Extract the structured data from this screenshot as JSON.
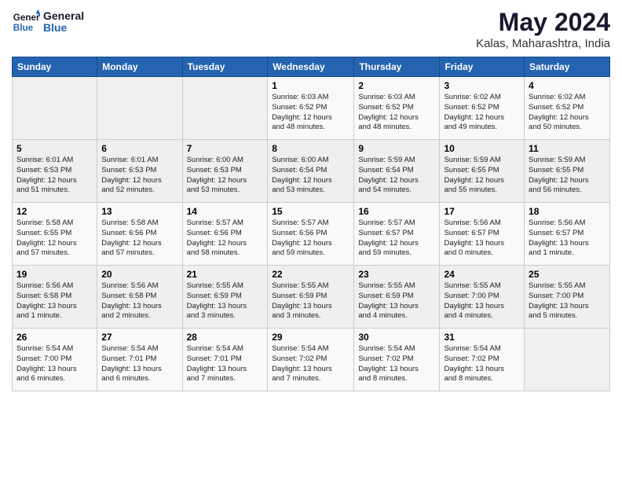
{
  "logo": {
    "line1": "General",
    "line2": "Blue"
  },
  "title": "May 2024",
  "subtitle": "Kalas, Maharashtra, India",
  "days_of_week": [
    "Sunday",
    "Monday",
    "Tuesday",
    "Wednesday",
    "Thursday",
    "Friday",
    "Saturday"
  ],
  "weeks": [
    [
      {
        "day": "",
        "info": ""
      },
      {
        "day": "",
        "info": ""
      },
      {
        "day": "",
        "info": ""
      },
      {
        "day": "1",
        "info": "Sunrise: 6:03 AM\nSunset: 6:52 PM\nDaylight: 12 hours\nand 48 minutes."
      },
      {
        "day": "2",
        "info": "Sunrise: 6:03 AM\nSunset: 6:52 PM\nDaylight: 12 hours\nand 48 minutes."
      },
      {
        "day": "3",
        "info": "Sunrise: 6:02 AM\nSunset: 6:52 PM\nDaylight: 12 hours\nand 49 minutes."
      },
      {
        "day": "4",
        "info": "Sunrise: 6:02 AM\nSunset: 6:52 PM\nDaylight: 12 hours\nand 50 minutes."
      }
    ],
    [
      {
        "day": "5",
        "info": "Sunrise: 6:01 AM\nSunset: 6:53 PM\nDaylight: 12 hours\nand 51 minutes."
      },
      {
        "day": "6",
        "info": "Sunrise: 6:01 AM\nSunset: 6:53 PM\nDaylight: 12 hours\nand 52 minutes."
      },
      {
        "day": "7",
        "info": "Sunrise: 6:00 AM\nSunset: 6:53 PM\nDaylight: 12 hours\nand 53 minutes."
      },
      {
        "day": "8",
        "info": "Sunrise: 6:00 AM\nSunset: 6:54 PM\nDaylight: 12 hours\nand 53 minutes."
      },
      {
        "day": "9",
        "info": "Sunrise: 5:59 AM\nSunset: 6:54 PM\nDaylight: 12 hours\nand 54 minutes."
      },
      {
        "day": "10",
        "info": "Sunrise: 5:59 AM\nSunset: 6:55 PM\nDaylight: 12 hours\nand 55 minutes."
      },
      {
        "day": "11",
        "info": "Sunrise: 5:59 AM\nSunset: 6:55 PM\nDaylight: 12 hours\nand 56 minutes."
      }
    ],
    [
      {
        "day": "12",
        "info": "Sunrise: 5:58 AM\nSunset: 6:55 PM\nDaylight: 12 hours\nand 57 minutes."
      },
      {
        "day": "13",
        "info": "Sunrise: 5:58 AM\nSunset: 6:56 PM\nDaylight: 12 hours\nand 57 minutes."
      },
      {
        "day": "14",
        "info": "Sunrise: 5:57 AM\nSunset: 6:56 PM\nDaylight: 12 hours\nand 58 minutes."
      },
      {
        "day": "15",
        "info": "Sunrise: 5:57 AM\nSunset: 6:56 PM\nDaylight: 12 hours\nand 59 minutes."
      },
      {
        "day": "16",
        "info": "Sunrise: 5:57 AM\nSunset: 6:57 PM\nDaylight: 12 hours\nand 59 minutes."
      },
      {
        "day": "17",
        "info": "Sunrise: 5:56 AM\nSunset: 6:57 PM\nDaylight: 13 hours\nand 0 minutes."
      },
      {
        "day": "18",
        "info": "Sunrise: 5:56 AM\nSunset: 6:57 PM\nDaylight: 13 hours\nand 1 minute."
      }
    ],
    [
      {
        "day": "19",
        "info": "Sunrise: 5:56 AM\nSunset: 6:58 PM\nDaylight: 13 hours\nand 1 minute."
      },
      {
        "day": "20",
        "info": "Sunrise: 5:56 AM\nSunset: 6:58 PM\nDaylight: 13 hours\nand 2 minutes."
      },
      {
        "day": "21",
        "info": "Sunrise: 5:55 AM\nSunset: 6:59 PM\nDaylight: 13 hours\nand 3 minutes."
      },
      {
        "day": "22",
        "info": "Sunrise: 5:55 AM\nSunset: 6:59 PM\nDaylight: 13 hours\nand 3 minutes."
      },
      {
        "day": "23",
        "info": "Sunrise: 5:55 AM\nSunset: 6:59 PM\nDaylight: 13 hours\nand 4 minutes."
      },
      {
        "day": "24",
        "info": "Sunrise: 5:55 AM\nSunset: 7:00 PM\nDaylight: 13 hours\nand 4 minutes."
      },
      {
        "day": "25",
        "info": "Sunrise: 5:55 AM\nSunset: 7:00 PM\nDaylight: 13 hours\nand 5 minutes."
      }
    ],
    [
      {
        "day": "26",
        "info": "Sunrise: 5:54 AM\nSunset: 7:00 PM\nDaylight: 13 hours\nand 6 minutes."
      },
      {
        "day": "27",
        "info": "Sunrise: 5:54 AM\nSunset: 7:01 PM\nDaylight: 13 hours\nand 6 minutes."
      },
      {
        "day": "28",
        "info": "Sunrise: 5:54 AM\nSunset: 7:01 PM\nDaylight: 13 hours\nand 7 minutes."
      },
      {
        "day": "29",
        "info": "Sunrise: 5:54 AM\nSunset: 7:02 PM\nDaylight: 13 hours\nand 7 minutes."
      },
      {
        "day": "30",
        "info": "Sunrise: 5:54 AM\nSunset: 7:02 PM\nDaylight: 13 hours\nand 8 minutes."
      },
      {
        "day": "31",
        "info": "Sunrise: 5:54 AM\nSunset: 7:02 PM\nDaylight: 13 hours\nand 8 minutes."
      },
      {
        "day": "",
        "info": ""
      }
    ]
  ]
}
